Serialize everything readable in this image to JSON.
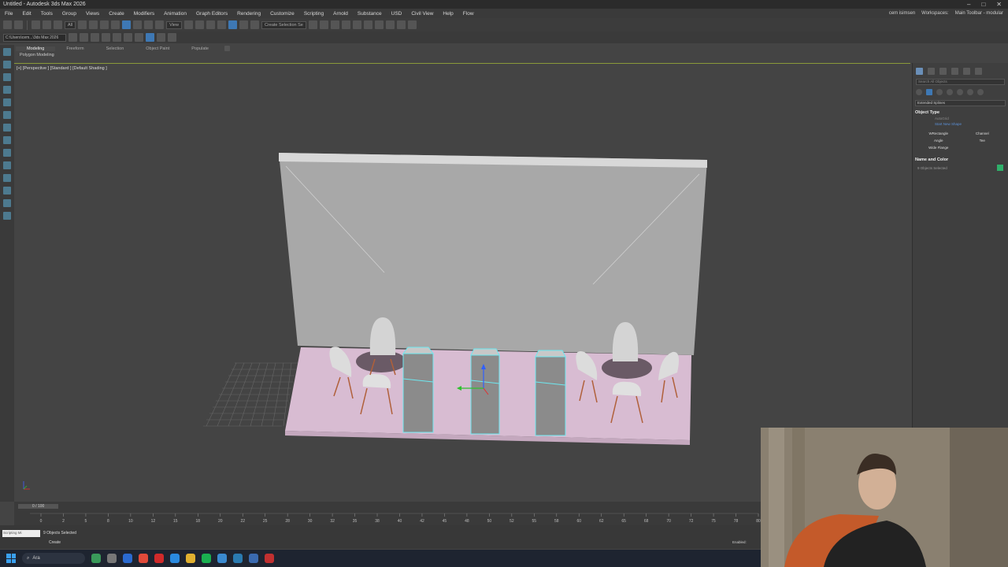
{
  "window": {
    "title": "Untitled - Autodesk 3ds Max 2026",
    "controls": [
      "–",
      "□",
      "✕"
    ]
  },
  "menubar": {
    "items": [
      "File",
      "Edit",
      "Tools",
      "Group",
      "Views",
      "Create",
      "Modifiers",
      "Animation",
      "Graph Editors",
      "Rendering",
      "Customize",
      "Scripting",
      "Arnold",
      "Substance",
      "USD",
      "Civil View",
      "Help",
      "Flow"
    ],
    "user": "cem isimsen",
    "workspaces_label": "Workspaces:",
    "workspace_value": "Main Toolbar - modular"
  },
  "toolbar": {
    "filter_value": "All",
    "view_value": "View",
    "selection_set_placeholder": "Create Selection Se"
  },
  "toolbar2": {
    "project_path": "C:\\Users\\cem...\\3ds Max 2026"
  },
  "ribbon": {
    "tabs": [
      "Modeling",
      "Freeform",
      "Selection",
      "Object Paint",
      "Populate"
    ],
    "active_tab": "Modeling",
    "sub_label": "Polygon Modeling"
  },
  "viewport": {
    "label": "[+] [Perspective ] [Standard ] [Default Shading ]"
  },
  "command_panel": {
    "search_placeholder": "Search All Objects",
    "category_value": "Extended Splines",
    "object_type_title": "Object Type",
    "autogrid_label": "AutoGrid",
    "start_new_shape_label": "Start New Shape",
    "buttons": [
      "WRectangle",
      "Channel",
      "Angle",
      "Tee",
      "Wide Flange"
    ],
    "name_color_title": "Name and Color",
    "objects_selected": "9 Objects Selected",
    "swatch_color": "#2fb06a"
  },
  "timeline": {
    "frame_display": "0 / 100",
    "ticks": [
      "0",
      "2",
      "5",
      "8",
      "10",
      "12",
      "15",
      "18",
      "20",
      "22",
      "25",
      "28",
      "30",
      "32",
      "35",
      "38",
      "40",
      "42",
      "45",
      "48",
      "50",
      "52",
      "55",
      "58",
      "60",
      "62",
      "65",
      "68",
      "70",
      "72",
      "75",
      "78",
      "80"
    ]
  },
  "statusbar": {
    "script_label": "Scripting Mi",
    "selection_status": "9 Objects Selected",
    "prompt": "Create",
    "enabled_label": "Enabled:"
  },
  "taskbar": {
    "search_label": "Ara"
  }
}
